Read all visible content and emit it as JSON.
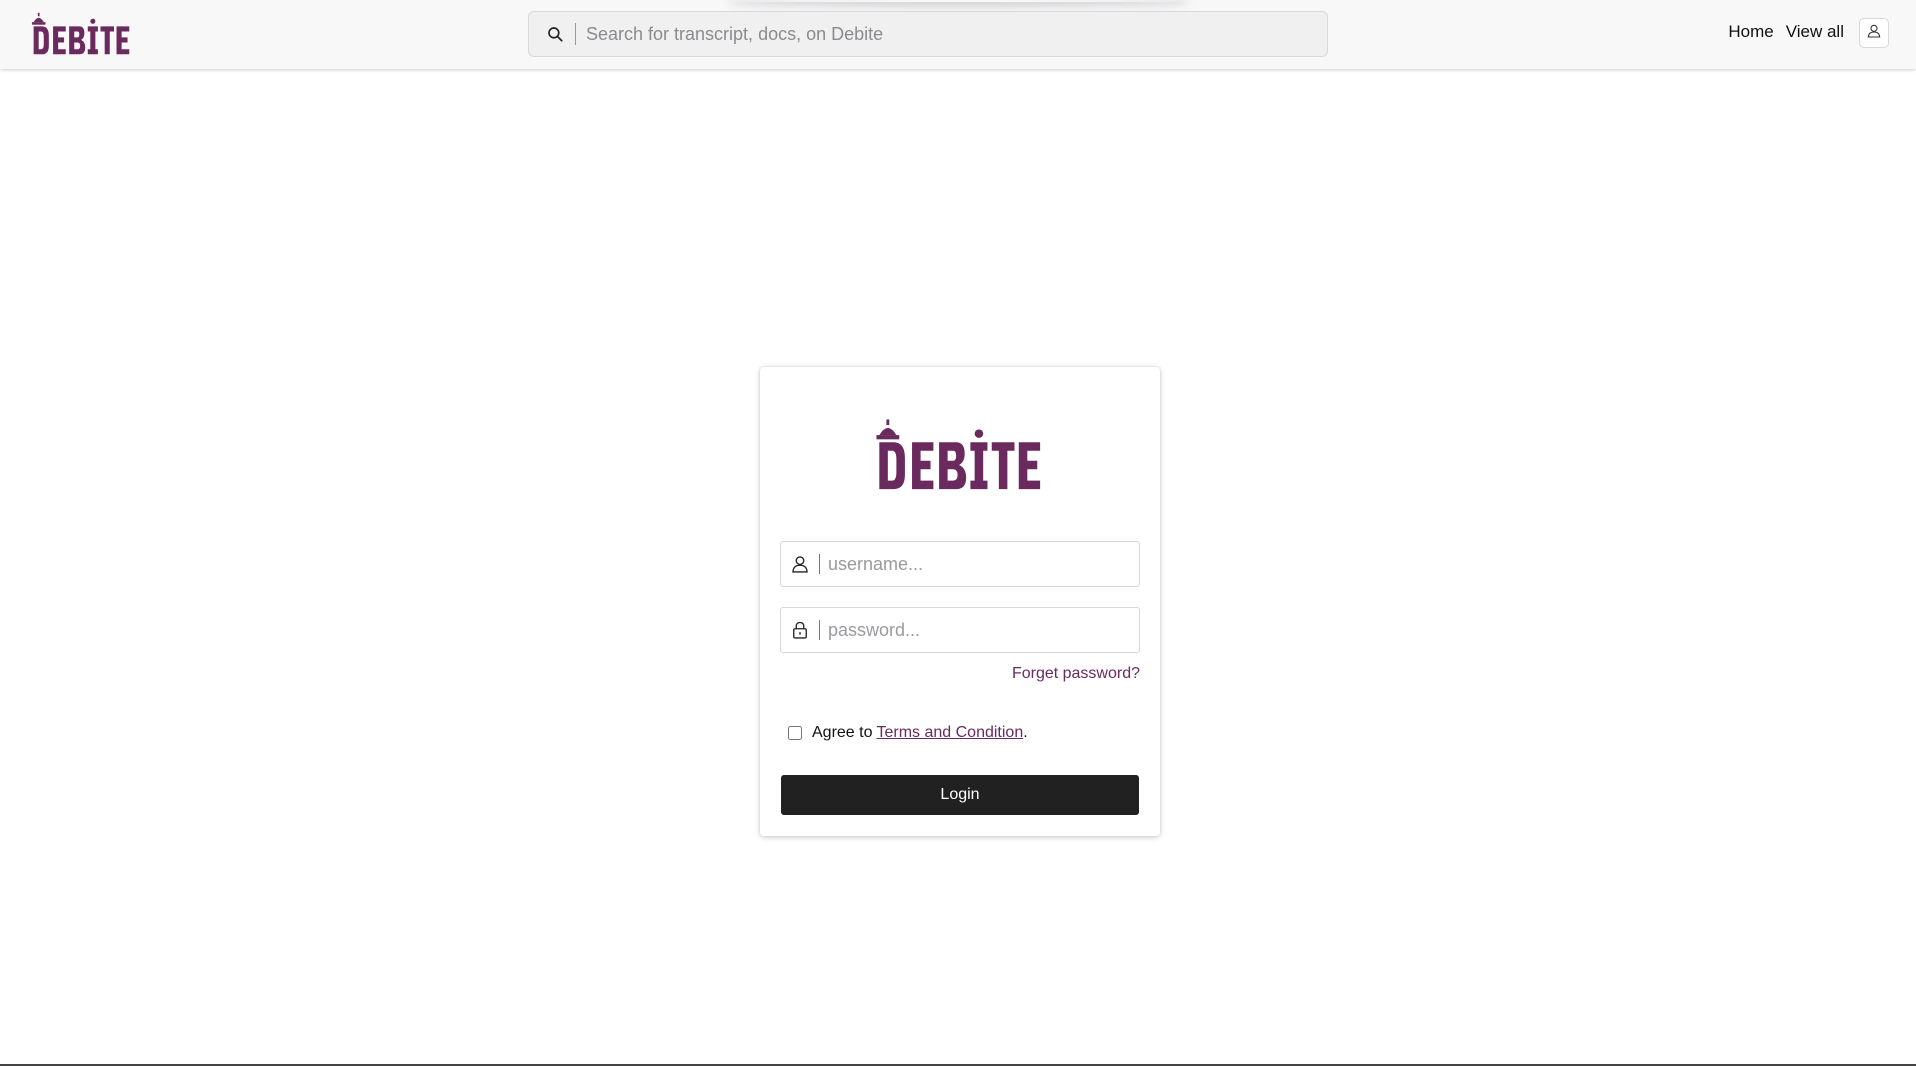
{
  "brand": {
    "name": "DEBITE",
    "color": "#6b2a5e"
  },
  "header": {
    "search_placeholder": "Search for transcript, docs, on Debite",
    "search_icon": "search-icon",
    "nav": [
      {
        "label": "Home"
      },
      {
        "label": "View all"
      }
    ],
    "user_icon": "user-icon"
  },
  "login": {
    "username_placeholder": "username...",
    "username_icon": "user-icon",
    "password_placeholder": "password...",
    "password_icon": "lock-icon",
    "forgot_label": "Forget password?",
    "agree_prefix": "Agree to",
    "terms_label": "Terms and Condition",
    "agree_suffix": ".",
    "agree_checked": false,
    "login_label": "Login"
  },
  "colors": {
    "accent": "#6b2a5e",
    "button_bg": "#212121",
    "header_bg": "#f8f8f9"
  }
}
